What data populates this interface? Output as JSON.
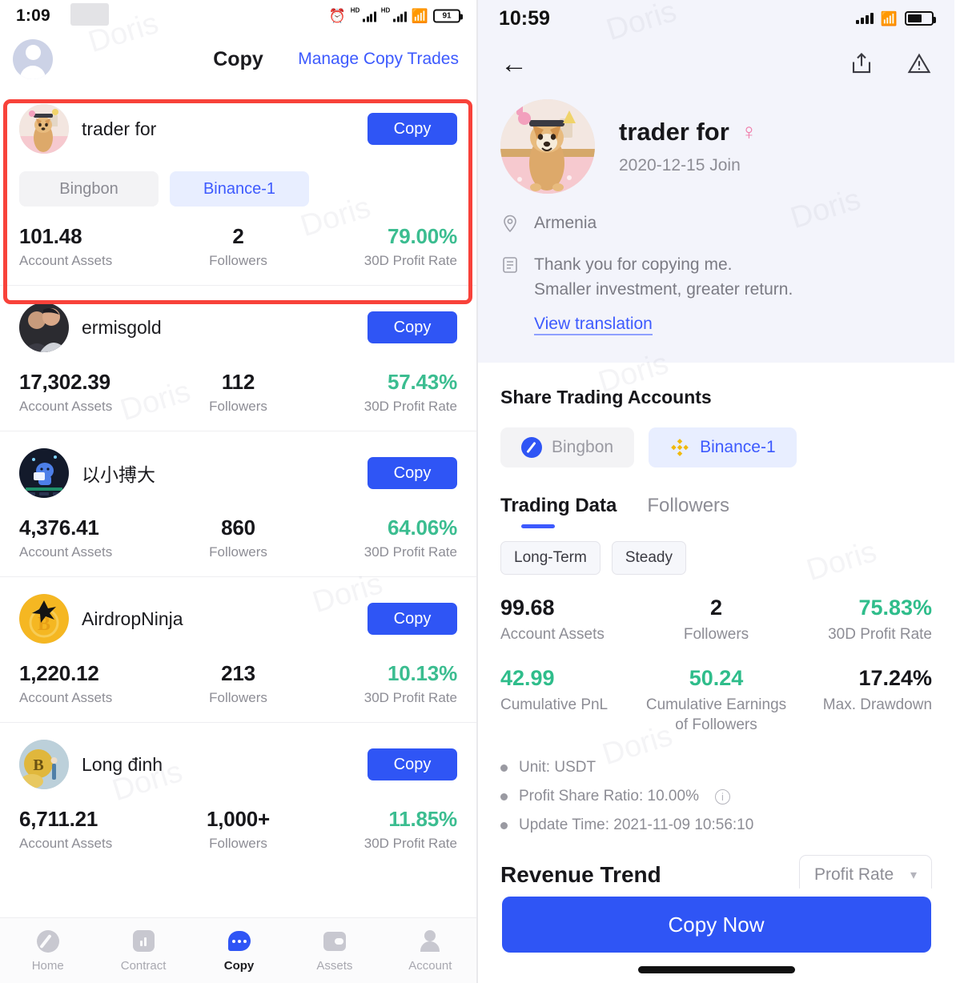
{
  "left": {
    "status": {
      "time": "1:09",
      "battery": "91",
      "network_label": "HD"
    },
    "header": {
      "title": "Copy",
      "manage_link": "Manage Copy Trades",
      "avatar_icon": "user-avatar-icon"
    },
    "traders": [
      {
        "name": "trader for",
        "copy_label": "Copy",
        "highlighted": true,
        "chips": [
          {
            "label": "Bingbon",
            "active": false
          },
          {
            "label": "Binance-1",
            "active": true
          }
        ],
        "assets_value": "101.48",
        "assets_label": "Account Assets",
        "followers_value": "2",
        "followers_label": "Followers",
        "profit_value": "79.00%",
        "profit_label": "30D Profit Rate"
      },
      {
        "name": "ermisgold",
        "copy_label": "Copy",
        "highlighted": false,
        "chips": [],
        "assets_value": "17,302.39",
        "assets_label": "Account Assets",
        "followers_value": "112",
        "followers_label": "Followers",
        "profit_value": "57.43%",
        "profit_label": "30D Profit Rate"
      },
      {
        "name": "以小搏大",
        "copy_label": "Copy",
        "highlighted": false,
        "chips": [],
        "assets_value": "4,376.41",
        "assets_label": "Account Assets",
        "followers_value": "860",
        "followers_label": "Followers",
        "profit_value": "64.06%",
        "profit_label": "30D Profit Rate"
      },
      {
        "name": "AirdropNinja",
        "copy_label": "Copy",
        "highlighted": false,
        "chips": [],
        "assets_value": "1,220.12",
        "assets_label": "Account Assets",
        "followers_value": "213",
        "followers_label": "Followers",
        "profit_value": "10.13%",
        "profit_label": "30D Profit Rate"
      },
      {
        "name": "Long đinh",
        "copy_label": "Copy",
        "highlighted": false,
        "chips": [],
        "assets_value": "6,711.21",
        "assets_label": "Account Assets",
        "followers_value": "1,000+",
        "followers_label": "Followers",
        "profit_value": "11.85%",
        "profit_label": "30D Profit Rate"
      }
    ],
    "tabbar": [
      {
        "label": "Home",
        "icon": "home-icon",
        "active": false
      },
      {
        "label": "Contract",
        "icon": "chart-bars-icon",
        "active": false
      },
      {
        "label": "Copy",
        "icon": "chat-bubble-icon",
        "active": true
      },
      {
        "label": "Assets",
        "icon": "wallet-icon",
        "active": false
      },
      {
        "label": "Account",
        "icon": "person-icon",
        "active": false
      }
    ]
  },
  "right": {
    "status": {
      "time": "10:59"
    },
    "nav": {
      "back_icon": "back-arrow-icon",
      "share_icon": "share-icon",
      "warning_icon": "warning-triangle-icon"
    },
    "profile": {
      "name": "trader for",
      "gender_icon": "female-gender-icon",
      "join_date": "2020-12-15 Join",
      "location_icon": "location-pin-icon",
      "location": "Armenia",
      "bio_icon": "note-icon",
      "bio_line1": "Thank you for copying me.",
      "bio_line2": "Smaller investment, greater return.",
      "translate_link": "View translation"
    },
    "share_accounts": {
      "title": "Share Trading Accounts",
      "chips": [
        {
          "label": "Bingbon",
          "icon": "bingbon-logo-icon",
          "active": false
        },
        {
          "label": "Binance-1",
          "icon": "binance-logo-icon",
          "active": true
        }
      ]
    },
    "data_tabs": [
      {
        "label": "Trading Data",
        "active": true
      },
      {
        "label": "Followers",
        "active": false
      }
    ],
    "tags": [
      "Long-Term",
      "Steady"
    ],
    "metrics_row1": [
      {
        "value": "99.68",
        "label": "Account Assets",
        "color": "dark"
      },
      {
        "value": "2",
        "label": "Followers",
        "color": "dark"
      },
      {
        "value": "75.83%",
        "label": "30D Profit Rate",
        "color": "green"
      }
    ],
    "metrics_row2": [
      {
        "value": "42.99",
        "label": "Cumulative PnL",
        "color": "green"
      },
      {
        "value": "50.24",
        "label": "Cumulative Earnings of Followers",
        "color": "green"
      },
      {
        "value": "17.24%",
        "label": "Max. Drawdown",
        "color": "dark"
      }
    ],
    "bullets": [
      {
        "text": "Unit: USDT",
        "has_info": false
      },
      {
        "text": "Profit Share Ratio: 10.00%",
        "has_info": true
      },
      {
        "text": "Update Time: 2021-11-09 10:56:10",
        "has_info": false
      }
    ],
    "revenue": {
      "title": "Revenue Trend",
      "select_value": "Profit Rate",
      "caret_icon": "chevron-down-icon"
    },
    "cta": {
      "label": "Copy Now"
    }
  },
  "watermark": "Doris",
  "colors": {
    "accent_blue": "#2f55f5",
    "link_blue": "#3d5afe",
    "profit_green": "#3bbd90",
    "highlight_red": "#f8423a",
    "chip_active_bg": "#e8eeff"
  }
}
